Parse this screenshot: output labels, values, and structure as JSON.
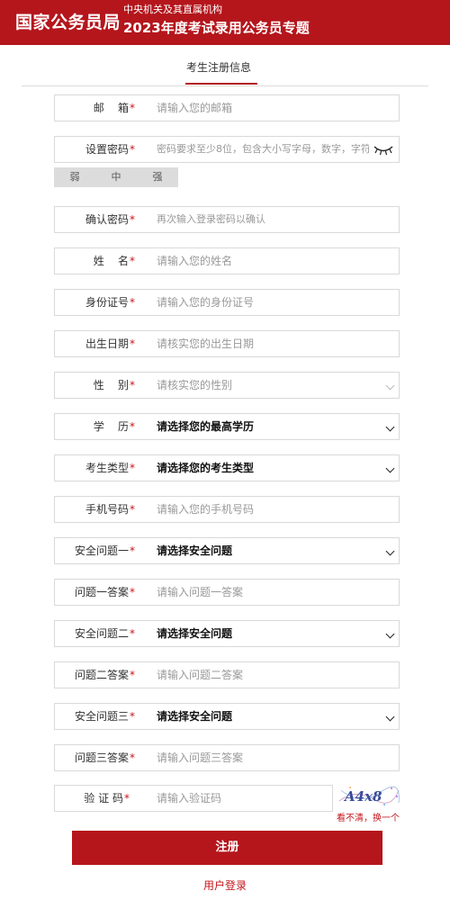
{
  "header": {
    "brand": "国家公务员局",
    "subtitle": "中央机关及其直属机构",
    "title": "2023年度考试录用公务员专题"
  },
  "tab": {
    "label": "考生注册信息"
  },
  "fields": {
    "email": {
      "label": "邮    箱",
      "placeholder": "请输入您的邮箱"
    },
    "password": {
      "label": "设置密码",
      "placeholder": "密码要求至少8位，包含大小写字母，数字，字符"
    },
    "strength": [
      "弱",
      "中",
      "强"
    ],
    "confirm": {
      "label": "确认密码",
      "placeholder": "再次输入登录密码以确认"
    },
    "name": {
      "label": "姓    名",
      "placeholder": "请输入您的姓名"
    },
    "idcard": {
      "label": "身份证号",
      "placeholder": "请输入您的身份证号"
    },
    "birth": {
      "label": "出生日期",
      "placeholder": "请核实您的出生日期"
    },
    "gender": {
      "label": "性    别",
      "placeholder": "请核实您的性别"
    },
    "education": {
      "label": "学    历",
      "value": "请选择您的最高学历"
    },
    "candidate_type": {
      "label": "考生类型",
      "value": "请选择您的考生类型"
    },
    "phone": {
      "label": "手机号码",
      "placeholder": "请输入您的手机号码"
    },
    "q1": {
      "label": "安全问题一",
      "value": "请选择安全问题"
    },
    "a1": {
      "label": "问题一答案",
      "placeholder": "请输入问题一答案"
    },
    "q2": {
      "label": "安全问题二",
      "value": "请选择安全问题"
    },
    "a2": {
      "label": "问题二答案",
      "placeholder": "请输入问题二答案"
    },
    "q3": {
      "label": "安全问题三",
      "value": "请选择安全问题"
    },
    "a3": {
      "label": "问题三答案",
      "placeholder": "请输入问题三答案"
    },
    "captcha": {
      "label": "验 证 码",
      "placeholder": "请输入验证码"
    }
  },
  "required_mark": "*",
  "captcha_image": {
    "text": "A4x8"
  },
  "captcha_refresh": "看不清，换一个",
  "submit_label": "注册",
  "login_link": "用户登录",
  "colors": {
    "brand_red": "#b4161c"
  }
}
